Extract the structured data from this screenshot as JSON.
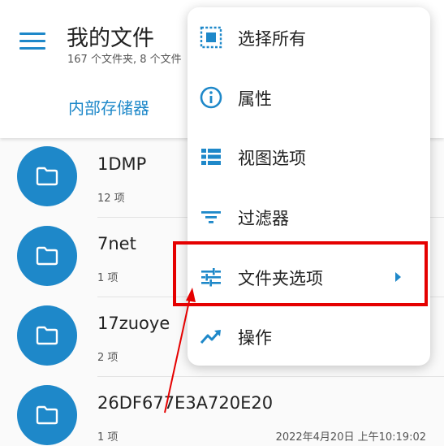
{
  "header": {
    "title": "我的文件",
    "subtitle": "167 个文件夹, 8 个文件",
    "breadcrumb": "内部存储器"
  },
  "files": [
    {
      "name": "1DMP",
      "count": "12 项",
      "date": ""
    },
    {
      "name": "7net",
      "count": "1 项",
      "date": ""
    },
    {
      "name": "17zuoye",
      "count": "2 项",
      "date": ""
    },
    {
      "name": "26DF677E3A720E20",
      "count": "1 项",
      "date": "2022年4月20日 上午10:19:02"
    }
  ],
  "menu": {
    "items": [
      {
        "label": "选择所有",
        "icon": "select-all-icon"
      },
      {
        "label": "属性",
        "icon": "info-icon"
      },
      {
        "label": "视图选项",
        "icon": "view-list-icon"
      },
      {
        "label": "过滤器",
        "icon": "filter-icon"
      },
      {
        "label": "文件夹选项",
        "icon": "tune-icon",
        "has_submenu": true
      },
      {
        "label": "操作",
        "icon": "trending-icon"
      }
    ]
  },
  "annotation": {
    "highlighted_item": "文件夹选项",
    "color": "#e50000"
  },
  "colors": {
    "accent": "#1e88c9",
    "annotation": "#e50000"
  }
}
